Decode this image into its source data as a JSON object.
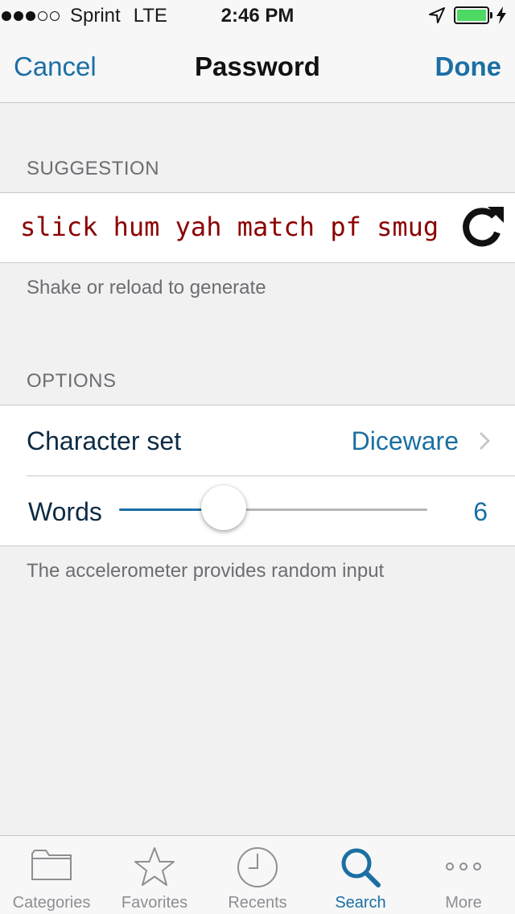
{
  "status_bar": {
    "carrier": "Sprint",
    "network": "LTE",
    "time": "2:46 PM",
    "signal_bars_filled": 3,
    "signal_bars_total": 5,
    "battery_level": 1.0
  },
  "nav": {
    "cancel_label": "Cancel",
    "title": "Password",
    "done_label": "Done"
  },
  "suggestion": {
    "header": "SUGGESTION",
    "password": "slick hum yah match pf smug",
    "footer": "Shake or reload to generate",
    "reload_icon": "reload-icon"
  },
  "options": {
    "header": "OPTIONS",
    "character_set_label": "Character set",
    "character_set_value": "Diceware",
    "words_label": "Words",
    "words_value": "6",
    "slider_fraction": 0.34,
    "footer": "The accelerometer provides random input"
  },
  "tabs": [
    {
      "label": "Categories",
      "icon": "folder-icon",
      "active": false
    },
    {
      "label": "Favorites",
      "icon": "star-icon",
      "active": false
    },
    {
      "label": "Recents",
      "icon": "clock-icon",
      "active": false
    },
    {
      "label": "Search",
      "icon": "search-icon",
      "active": true
    },
    {
      "label": "More",
      "icon": "more-icon",
      "active": false
    }
  ],
  "colors": {
    "accent": "#1b6fa3",
    "password_text": "#8b0000",
    "battery": "#4cd964"
  }
}
